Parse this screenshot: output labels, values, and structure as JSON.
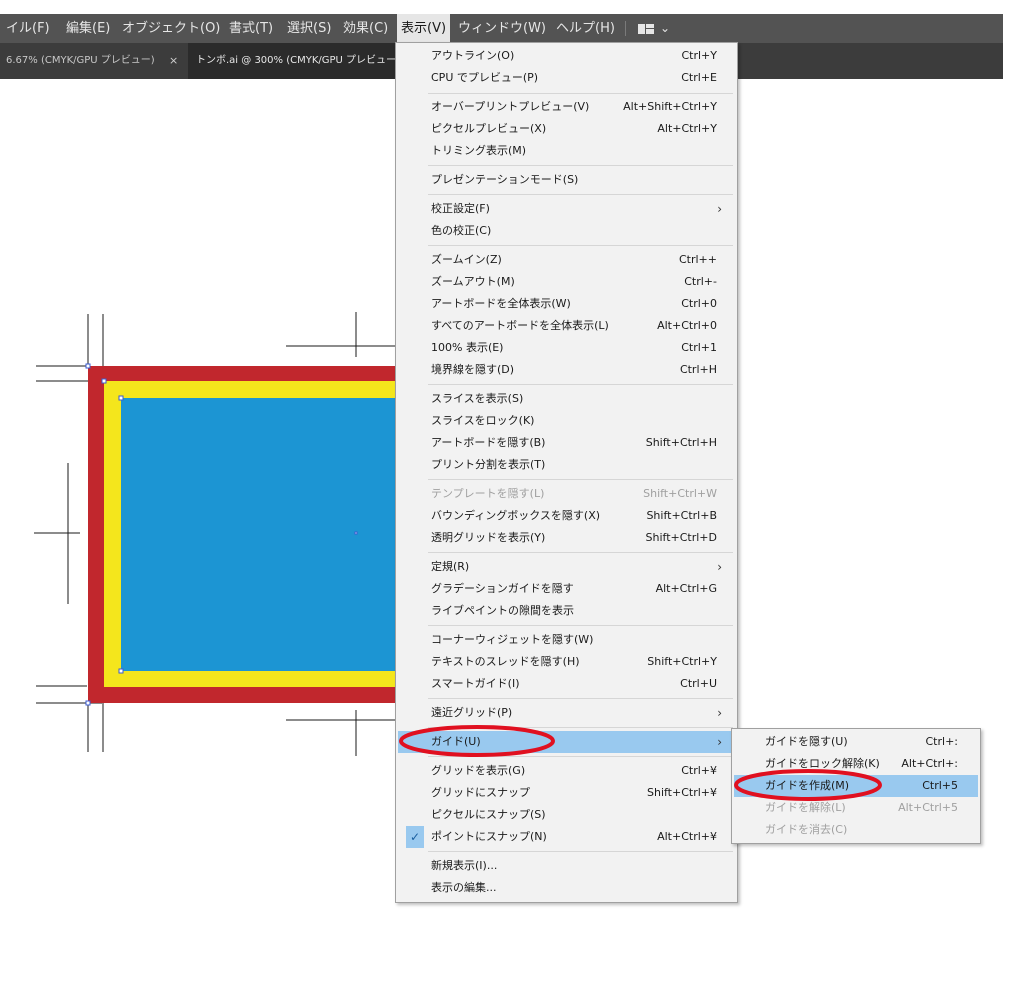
{
  "menubar": {
    "items": [
      "イル(F)",
      "編集(E)",
      "オブジェクト(O)",
      "書式(T)",
      "選択(S)",
      "効果(C)",
      "表示(V)",
      "ウィンドウ(W)",
      "ヘルプ(H)"
    ],
    "workspace_chevron": "⌄"
  },
  "tabs": {
    "tab1": "6.67% (CMYK/GPU プレビュー)",
    "close": "×",
    "tab2": "トンボ.ai @ 300% (CMYK/GPU プレビュー)"
  },
  "view_menu": {
    "items": [
      {
        "label": "アウトライン(O)",
        "shortcut": "Ctrl+Y"
      },
      {
        "label": "CPU でプレビュー(P)",
        "shortcut": "Ctrl+E"
      },
      {
        "label": "オーバープリントプレビュー(V)",
        "shortcut": "Alt+Shift+Ctrl+Y"
      },
      {
        "label": "ピクセルプレビュー(X)",
        "shortcut": "Alt+Ctrl+Y"
      },
      {
        "label": "トリミング表示(M)",
        "shortcut": ""
      },
      {
        "label": "プレゼンテーションモード(S)",
        "shortcut": ""
      },
      {
        "label": "校正設定(F)",
        "shortcut": "",
        "submenu": true
      },
      {
        "label": "色の校正(C)",
        "shortcut": ""
      },
      {
        "label": "ズームイン(Z)",
        "shortcut": "Ctrl++"
      },
      {
        "label": "ズームアウト(M)",
        "shortcut": "Ctrl+-"
      },
      {
        "label": "アートボードを全体表示(W)",
        "shortcut": "Ctrl+0"
      },
      {
        "label": "すべてのアートボードを全体表示(L)",
        "shortcut": "Alt+Ctrl+0"
      },
      {
        "label": "100% 表示(E)",
        "shortcut": "Ctrl+1"
      },
      {
        "label": "境界線を隠す(D)",
        "shortcut": "Ctrl+H"
      },
      {
        "label": "スライスを表示(S)",
        "shortcut": ""
      },
      {
        "label": "スライスをロック(K)",
        "shortcut": ""
      },
      {
        "label": "アートボードを隠す(B)",
        "shortcut": "Shift+Ctrl+H"
      },
      {
        "label": "プリント分割を表示(T)",
        "shortcut": ""
      },
      {
        "label": "テンプレートを隠す(L)",
        "shortcut": "Shift+Ctrl+W",
        "disabled": true
      },
      {
        "label": "バウンディングボックスを隠す(X)",
        "shortcut": "Shift+Ctrl+B"
      },
      {
        "label": "透明グリッドを表示(Y)",
        "shortcut": "Shift+Ctrl+D"
      },
      {
        "label": "定規(R)",
        "shortcut": "",
        "submenu": true
      },
      {
        "label": "グラデーションガイドを隠す",
        "shortcut": "Alt+Ctrl+G"
      },
      {
        "label": "ライブペイントの隙間を表示",
        "shortcut": ""
      },
      {
        "label": "コーナーウィジェットを隠す(W)",
        "shortcut": ""
      },
      {
        "label": "テキストのスレッドを隠す(H)",
        "shortcut": "Shift+Ctrl+Y"
      },
      {
        "label": "スマートガイド(I)",
        "shortcut": "Ctrl+U"
      },
      {
        "label": "遠近グリッド(P)",
        "shortcut": "",
        "submenu": true
      },
      {
        "label": "ガイド(U)",
        "shortcut": "",
        "submenu": true,
        "highlighted": true
      },
      {
        "label": "グリッドを表示(G)",
        "shortcut": "Ctrl+¥"
      },
      {
        "label": "グリッドにスナップ",
        "shortcut": "Shift+Ctrl+¥"
      },
      {
        "label": "ピクセルにスナップ(S)",
        "shortcut": ""
      },
      {
        "label": "ポイントにスナップ(N)",
        "shortcut": "Alt+Ctrl+¥",
        "checked": true
      },
      {
        "label": "新規表示(I)...",
        "shortcut": ""
      },
      {
        "label": "表示の編集...",
        "shortcut": ""
      }
    ],
    "submenu_arrow": "›",
    "check_mark": "✓"
  },
  "guide_submenu": {
    "items": [
      {
        "label": "ガイドを隠す(U)",
        "shortcut": "Ctrl+:"
      },
      {
        "label": "ガイドをロック解除(K)",
        "shortcut": "Alt+Ctrl+:"
      },
      {
        "label": "ガイドを作成(M)",
        "shortcut": "Ctrl+5",
        "highlighted": true
      },
      {
        "label": "ガイドを解除(L)",
        "shortcut": "Alt+Ctrl+5",
        "disabled": true
      },
      {
        "label": "ガイドを消去(C)",
        "shortcut": "",
        "disabled": true
      }
    ]
  },
  "colors": {
    "menubar_bg": "#535353",
    "menu_highlight": "#99c9ef",
    "annotation_red": "#e01020",
    "art_red": "#c1272d",
    "art_yellow": "#f4e61c",
    "art_blue": "#1c95d3"
  }
}
